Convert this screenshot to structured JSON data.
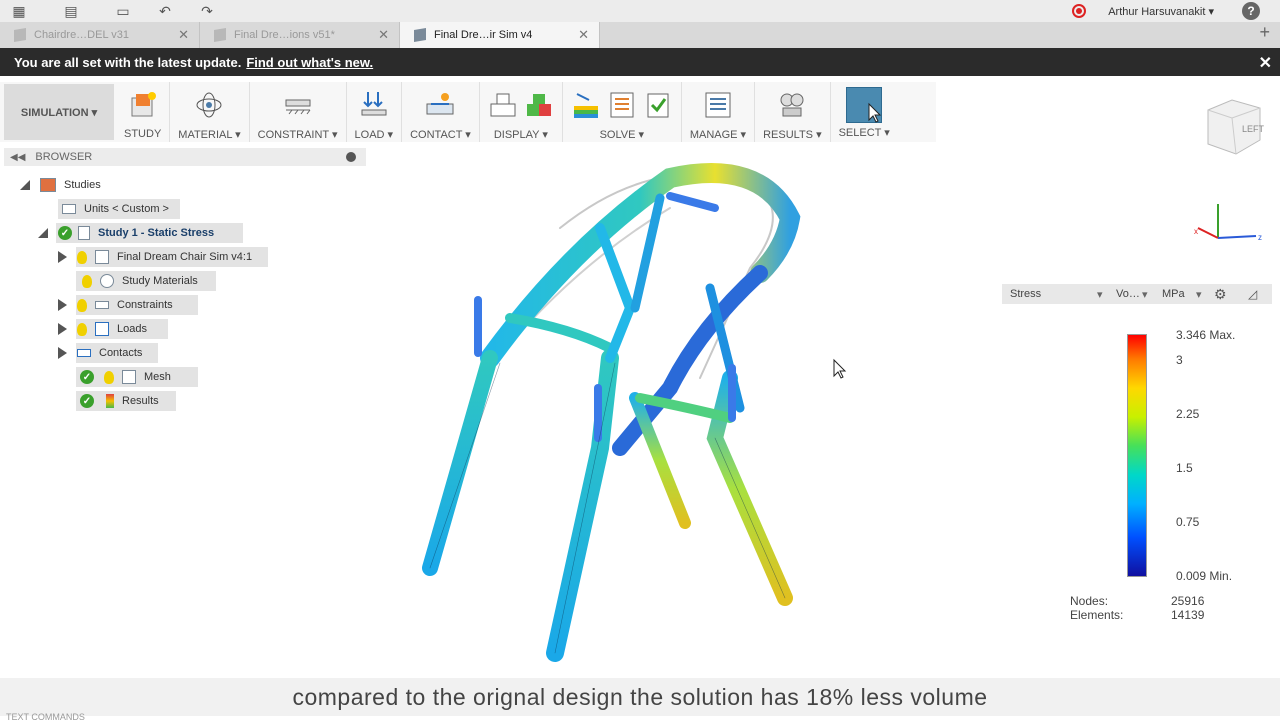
{
  "appbar": {
    "user": "Arthur Harsuvanakit ▾"
  },
  "tabs": [
    {
      "label": "Chairdre…DEL v31",
      "active": false
    },
    {
      "label": "Final Dre…ions v51*",
      "active": false
    },
    {
      "label": "Final Dre…ir Sim v4",
      "active": true
    }
  ],
  "notice": {
    "text": "You are all set with the latest update.",
    "link": "Find out what's new."
  },
  "toolbar": {
    "workspace": "SIMULATION ▾",
    "groups": [
      {
        "label": "STUDY"
      },
      {
        "label": "MATERIAL ▾"
      },
      {
        "label": "CONSTRAINT ▾"
      },
      {
        "label": "LOAD ▾"
      },
      {
        "label": "CONTACT ▾"
      },
      {
        "label": "DISPLAY ▾"
      },
      {
        "label": "SOLVE ▾"
      },
      {
        "label": "MANAGE ▾"
      },
      {
        "label": "RESULTS ▾"
      },
      {
        "label": "SELECT ▾"
      }
    ]
  },
  "browser": {
    "title": "BROWSER",
    "items": [
      {
        "label": "Studies"
      },
      {
        "label": "Units < Custom >"
      },
      {
        "label": "Study 1 - Static Stress"
      },
      {
        "label": "Final Dream Chair Sim v4:1"
      },
      {
        "label": "Study Materials"
      },
      {
        "label": "Constraints"
      },
      {
        "label": "Loads"
      },
      {
        "label": "Contacts"
      },
      {
        "label": "Mesh"
      },
      {
        "label": "Results"
      }
    ]
  },
  "legend": {
    "result": "Stress",
    "option": "Vo…",
    "unit": "MPa",
    "ticks": [
      "3.346 Max.",
      "3",
      "2.25",
      "1.5",
      "0.75",
      "0.009 Min."
    ],
    "nodes_label": "Nodes:",
    "nodes_value": "25916",
    "elements_label": "Elements:",
    "elements_value": "14139"
  },
  "viewcube": {
    "face": "LEFT"
  },
  "caption": "compared to the orignal design the solution has 18% less volume",
  "text_commands": "TEXT COMMANDS"
}
